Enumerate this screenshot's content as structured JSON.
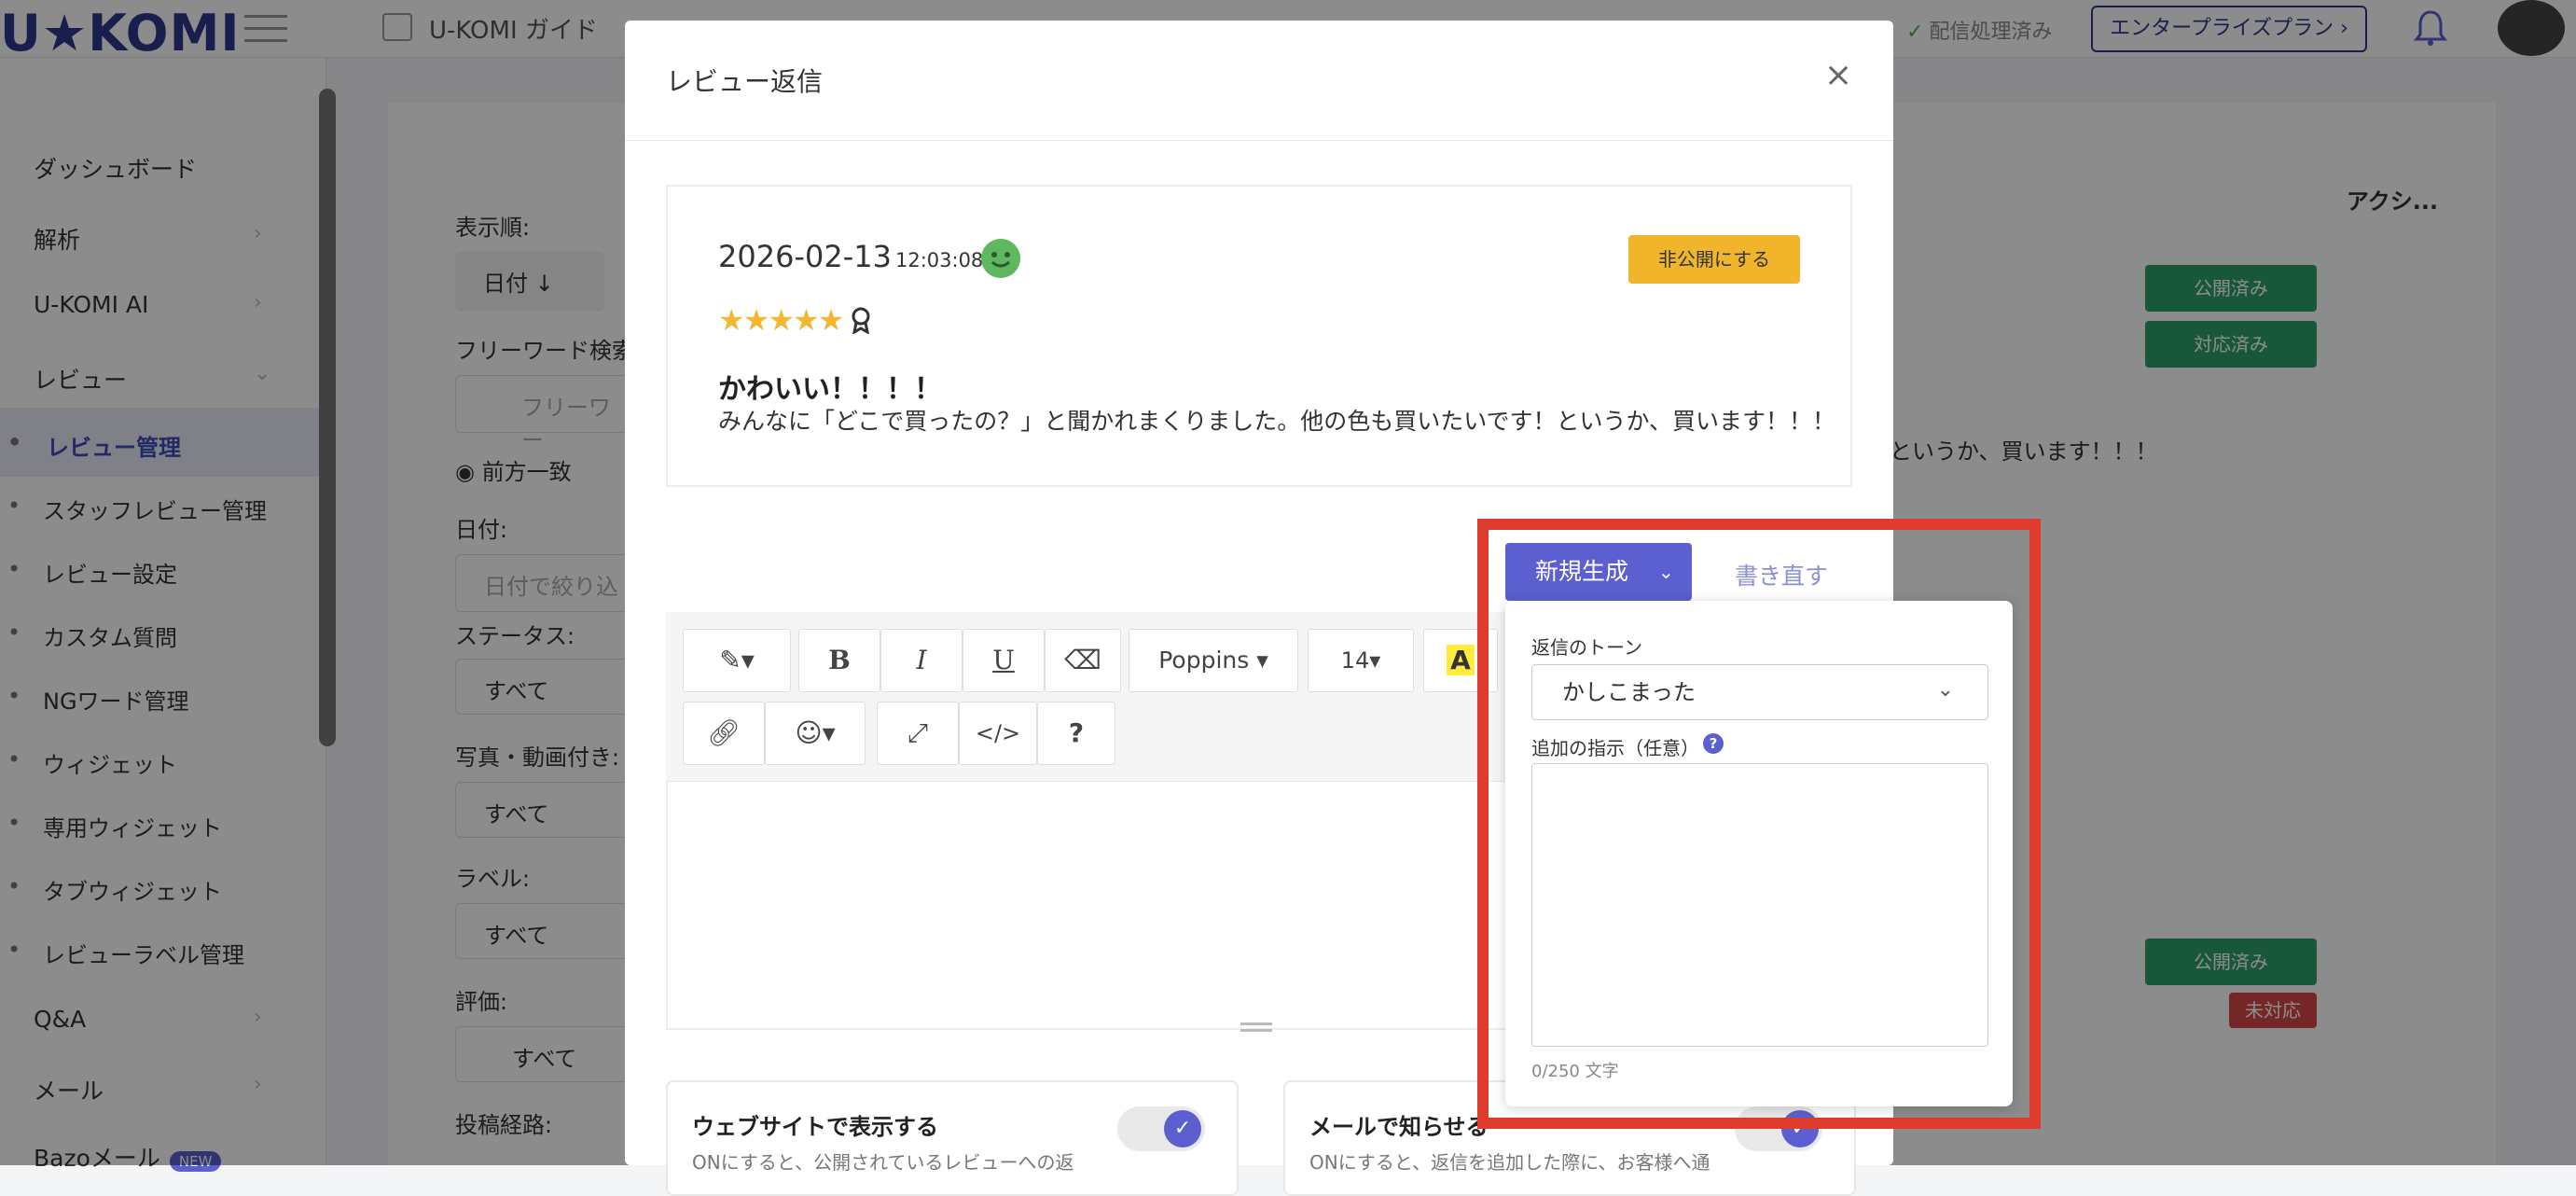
{
  "app": {
    "logo": "U★KOMI",
    "guide": "U-KOMI ガイド",
    "status": "配信処理済み",
    "plan": "エンタープライズプラン ›"
  },
  "sidebar": {
    "items": [
      {
        "label": "ダッシュボード"
      },
      {
        "label": "解析"
      },
      {
        "label": "U-KOMI AI"
      },
      {
        "label": "レビュー"
      }
    ],
    "subitems": [
      {
        "label": "レビュー管理"
      },
      {
        "label": "スタッフレビュー管理"
      },
      {
        "label": "レビュー設定"
      },
      {
        "label": "カスタム質問"
      },
      {
        "label": "NGワード管理"
      },
      {
        "label": "ウィジェット"
      },
      {
        "label": "専用ウィジェット"
      },
      {
        "label": "タブウィジェット"
      },
      {
        "label": "レビューラベル管理"
      }
    ],
    "bottom": [
      {
        "label": "Q&A"
      },
      {
        "label": "メール"
      },
      {
        "label": "Bazoメール"
      }
    ],
    "new_badge": "NEW"
  },
  "background": {
    "sort_label": "表示順:",
    "sort_value": "日付 ↓",
    "keyword_label": "フリーワード検索",
    "keyword_placeholder": "フリーワー",
    "match_label": "前方一致",
    "date_label": "日付:",
    "date_placeholder": "日付で絞り込",
    "status_label": "ステータス:",
    "status_value": "すべて",
    "photo_label": "写真・動画付き:",
    "photo_value": "すべて",
    "label_label": "ラベル:",
    "label_value": "すべて",
    "rating_label": "評価:",
    "rating_value": "すべて",
    "channel_label": "投稿経路:",
    "action_header": "アクシ...",
    "tag_published": "公開済み",
    "tag_handled": "対応済み",
    "tag_unhandled": "未対応",
    "snippet": "というか、買います！！！"
  },
  "modal": {
    "title": "レビュー返信",
    "close": "×",
    "review": {
      "date": "2026-02-13",
      "time": "12:03:08",
      "hide_button": "非公開にする",
      "stars": "★★★★★",
      "rating": 5,
      "title": "かわいい！！！！",
      "body": "みんなに「どこで買ったの？」と聞かれまくりました。他の色も買いたいです！というか、買います！！！"
    },
    "editor": {
      "font": "Poppins ▾",
      "size": "14▾",
      "bold": "B",
      "italic": "I",
      "underline": "U",
      "code": "</>",
      "help": "?"
    },
    "toggles": [
      {
        "title": "ウェブサイトで表示する",
        "sub": "ONにすると、公開されているレビューへの返"
      },
      {
        "title": "メールで知らせる",
        "sub": "ONにすると、返信を追加した際に、お客様へ通"
      }
    ],
    "generate": {
      "button": "新規生成",
      "rewrite": "書き直す",
      "tone_label": "返信のトーン",
      "tone_value": "かしこまった",
      "instruction_label": "追加の指示（任意）",
      "counter": "0/250 文字"
    }
  },
  "colors": {
    "accent": "#5b5fcf",
    "highlight": "#e03c2d",
    "hide_button": "#f1b52b",
    "published": "#2f9e6a",
    "unhandled": "#d64545"
  }
}
